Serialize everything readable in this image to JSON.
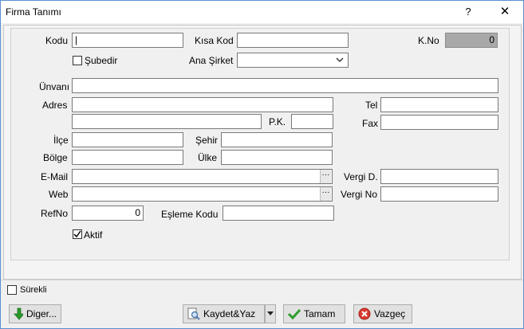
{
  "window": {
    "title": "Firma Tanımı",
    "help_glyph": "?",
    "close_glyph": "✕"
  },
  "form": {
    "kodu_label": "Kodu",
    "kodu_value": "|",
    "kisa_kod_label": "Kısa Kod",
    "kisa_kod_value": "",
    "kno_label": "K.No",
    "kno_value": "0",
    "subedir_label": "Şubedir",
    "subedir_checked": false,
    "ana_sirket_label": "Ana Şirket",
    "ana_sirket_value": "",
    "unvani_label": "Ünvanı",
    "unvani_value": "",
    "adres_label": "Adres",
    "adres1_value": "",
    "adres2_value": "",
    "tel_label": "Tel",
    "tel_value": "",
    "pk_label": "P.K.",
    "pk_value": "",
    "fax_label": "Fax",
    "fax_value": "",
    "ilce_label": "İlçe",
    "ilce_value": "",
    "sehir_label": "Şehir",
    "sehir_value": "",
    "bolge_label": "Bölge",
    "bolge_value": "",
    "ulke_label": "Ülke",
    "ulke_value": "",
    "email_label": "E-Mail",
    "email_value": "",
    "vergi_d_label": "Vergi D.",
    "vergi_d_value": "",
    "web_label": "Web",
    "web_value": "",
    "vergi_no_label": "Vergi No",
    "vergi_no_value": "",
    "refno_label": "RefNo",
    "refno_value": "0",
    "esleme_kodu_label": "Eşleme Kodu",
    "esleme_kodu_value": "",
    "aktif_label": "Aktif",
    "aktif_checked": true,
    "ellipsis": "···"
  },
  "footer": {
    "surekli_label": "Sürekli",
    "surekli_checked": false,
    "diger_label": "Diger...",
    "kaydet_label": "Kaydet&Yaz",
    "tamam_label": "Tamam",
    "vazgec_label": "Vazgeç"
  },
  "colors": {
    "accent_border": "#5a8fd0",
    "readonly_field": "#a9a9a9",
    "ok_green": "#2e9e2e",
    "cancel_red": "#d83a2e",
    "down_green": "#2a9a2a"
  },
  "icons": [
    "help-icon",
    "close-icon",
    "chevron-down-icon",
    "ellipsis-icon",
    "checkmark-icon",
    "arrow-down-icon",
    "print-preview-icon",
    "cancel-icon"
  ]
}
